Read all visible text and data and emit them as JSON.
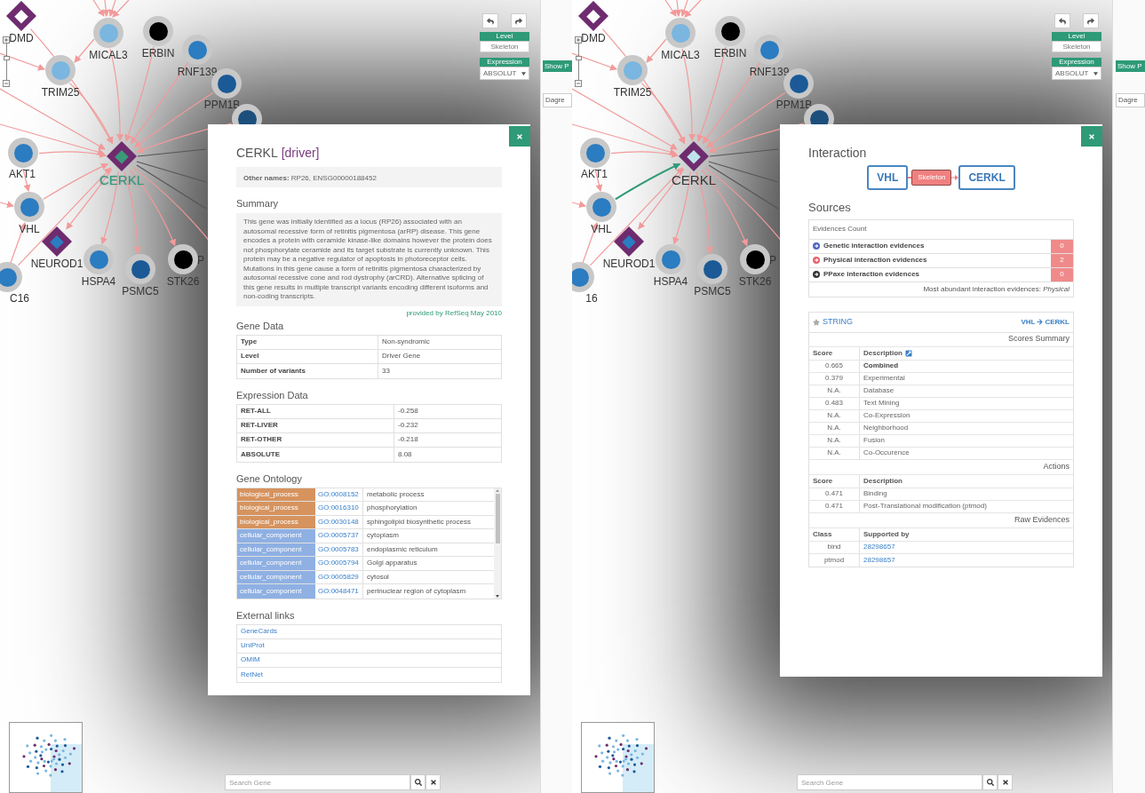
{
  "panes": [
    {
      "graph": {
        "nodes": [
          {
            "label": "DMD",
            "kind": "diamond",
            "color": "#ffffff",
            "selected": false,
            "edge_selected": false
          },
          {
            "label": "MICAL3",
            "kind": "circle",
            "color": "#7ab6df",
            "selected": false,
            "edge_selected": false
          },
          {
            "label": "ERBIN",
            "kind": "circle",
            "color": "#000000",
            "selected": false,
            "edge_selected": false
          },
          {
            "label": "RNF139",
            "kind": "circle",
            "color": "#2b7cc1",
            "selected": false,
            "edge_selected": false
          },
          {
            "label": "TRIM25",
            "kind": "circle",
            "color": "#7ab6df",
            "selected": false,
            "edge_selected": false
          },
          {
            "label": "PPM1B",
            "kind": "circle",
            "color": "#1b5a96",
            "selected": false,
            "edge_selected": false
          },
          {
            "kind": "circle",
            "color": "#1d4f7c",
            "selected": false,
            "edge_selected": false
          },
          {
            "label": "AKT1",
            "kind": "circle",
            "color": "#2b7cc1",
            "selected": false,
            "edge_selected": false
          },
          {
            "label": "CERKL",
            "kind": "diamond",
            "color": "#3a9a7a",
            "selected": true
          },
          {
            "label": "VHL",
            "kind": "circle",
            "color": "#2b7cc1",
            "selected": false,
            "edge_selected": false
          },
          {
            "label": "NEUROD1",
            "kind": "diamond",
            "color": "#2b7cc1",
            "selected": false,
            "edge_selected": false
          },
          {
            "label": "HSPA4",
            "kind": "circle",
            "color": "#2b7cc1",
            "selected": false,
            "edge_selected": false
          },
          {
            "label": "PSMC5",
            "kind": "circle",
            "color": "#1b5a96",
            "selected": false,
            "edge_selected": false
          },
          {
            "label": "STK26",
            "kind": "circle",
            "color": "#000000",
            "selected": false,
            "edge_selected": false
          },
          {
            "label": "P",
            "kind": "covered",
            "selected": false,
            "edge_selected": false
          },
          {
            "label": "C16",
            "kind": "circle",
            "color": "#2b7cc1",
            "selected": false,
            "edge_selected": false
          }
        ]
      },
      "zoom": {
        "level": 0.65
      },
      "toolbar": {
        "level_label": "Level",
        "level_value": "Skeleton",
        "expression_label": "Expression",
        "expression_value": "ABSOLUT"
      },
      "side_buttons": [
        {
          "label": "Show P",
          "kind": "primary"
        },
        {
          "label": "Dagre",
          "kind": "plain"
        }
      ],
      "search": {
        "placeholder": "Search Gene"
      },
      "modal": {
        "kind": "gene",
        "title": "CERKL",
        "tag": "[driver]",
        "other_names": "**Other names:** RP26, ENSG00000188452",
        "summary_heading": "Summary",
        "summary": "This gene was initially identified as a locus (RP26) associated with an autosomal recessive form of retinitis pigmentosa (arRP) disease. This gene encodes a protein with ceramide kinase-like domains however the protein does not phosphorylate ceramide and its target substrate is currently unknown. This protein may be a negative regulator of apoptosis in photoreceptor cells. Mutations in this gene cause a form of retinitis pigmentosa characterized by autosomal recessive cone and rod dystrophy (arCRD). Alternative splicing of this gene results in multiple transcript variants encoding different isoforms and non-coding transcripts.",
        "source_note": "provided by RefSeq May 2010",
        "gene_data": {
          "heading": "Gene Data",
          "rows": [
            {
              "label": "Type",
              "value": "Non-syndromic"
            },
            {
              "label": "Level",
              "value": "Driver Gene"
            },
            {
              "label": "Number of variants",
              "value": "33"
            }
          ]
        },
        "expression": {
          "heading": "Expression Data",
          "rows": [
            {
              "label": "RET-ALL",
              "value": "-0.258"
            },
            {
              "label": "RET-LIVER",
              "value": "-0.232"
            },
            {
              "label": "RET-OTHER",
              "value": "-0.218"
            },
            {
              "label": "ABSOLUTE",
              "value": "8.08"
            }
          ]
        },
        "ontology": {
          "heading": "Gene Ontology",
          "rows": [
            {
              "category": "biological_process",
              "color": "#d6935e",
              "id": "GO:0008152",
              "term": "metabolic process"
            },
            {
              "category": "biological_process",
              "color": "#d6935e",
              "id": "GO:0016310",
              "term": "phosphorylation"
            },
            {
              "category": "biological_process",
              "color": "#d6935e",
              "id": "GO:0030148",
              "term": "sphingolipid biosynthetic process"
            },
            {
              "category": "cellular_component",
              "color": "#8fb0e3",
              "id": "GO:0005737",
              "term": "cytoplasm"
            },
            {
              "category": "cellular_component",
              "color": "#8fb0e3",
              "id": "GO:0005783",
              "term": "endoplasmic reticulum"
            },
            {
              "category": "cellular_component",
              "color": "#8fb0e3",
              "id": "GO:0005794",
              "term": "Golgi apparatus"
            },
            {
              "category": "cellular_component",
              "color": "#8fb0e3",
              "id": "GO:0005829",
              "term": "cytosol"
            },
            {
              "category": "cellular_component",
              "color": "#8fb0e3",
              "id": "GO:0048471",
              "term": "perinuclear region of cytoplasm"
            }
          ]
        },
        "links": {
          "heading": "External links",
          "items": [
            "GeneCards",
            "UniProt",
            "OMIM",
            "RetNet"
          ]
        }
      }
    },
    {
      "graph": {
        "nodes": [
          {
            "label": "DMD",
            "kind": "diamond",
            "color": "#ffffff",
            "selected": false,
            "edge_selected": false
          },
          {
            "label": "MICAL3",
            "kind": "circle",
            "color": "#7ab6df",
            "selected": false,
            "edge_selected": false
          },
          {
            "label": "ERBIN",
            "kind": "circle",
            "color": "#000000",
            "selected": false,
            "edge_selected": false
          },
          {
            "label": "RNF139",
            "kind": "circle",
            "color": "#2b7cc1",
            "selected": false,
            "edge_selected": false
          },
          {
            "label": "TRIM25",
            "kind": "circle",
            "color": "#7ab6df",
            "selected": false,
            "edge_selected": false
          },
          {
            "label": "PPM1B",
            "kind": "circle",
            "color": "#1b5a96",
            "selected": false,
            "edge_selected": false
          },
          {
            "kind": "circle",
            "color": "#1d4f7c",
            "selected": false,
            "edge_selected": false
          },
          {
            "label": "AKT1",
            "kind": "circle",
            "color": "#2b7cc1",
            "selected": false,
            "edge_selected": false
          },
          {
            "label": "CERKL",
            "kind": "diamond",
            "color": "#bfe3ea",
            "selected": false
          },
          {
            "label": "VHL",
            "kind": "circle",
            "color": "#2b7cc1",
            "selected": false,
            "edge_selected": true
          },
          {
            "label": "NEUROD1",
            "kind": "diamond",
            "color": "#2b7cc1",
            "selected": false,
            "edge_selected": false
          },
          {
            "label": "HSPA4",
            "kind": "circle",
            "color": "#2b7cc1",
            "selected": false,
            "edge_selected": false
          },
          {
            "label": "PSMC5",
            "kind": "circle",
            "color": "#1b5a96",
            "selected": false,
            "edge_selected": false
          },
          {
            "label": "STK26",
            "kind": "circle",
            "color": "#000000",
            "selected": false,
            "edge_selected": false
          },
          {
            "label": "P",
            "kind": "covered",
            "selected": false,
            "edge_selected": false
          },
          {
            "label": "16",
            "kind": "circle",
            "color": "#2b7cc1",
            "selected": false,
            "edge_selected": false
          }
        ]
      },
      "zoom": {
        "level": 0.65
      },
      "toolbar": {
        "level_label": "Level",
        "level_value": "Skeleton",
        "expression_label": "Expression",
        "expression_value": "ABSOLUT"
      },
      "side_buttons": [
        {
          "label": "Show P",
          "kind": "primary"
        },
        {
          "label": "Dagre",
          "kind": "plain"
        }
      ],
      "search": {
        "placeholder": "Search Gene"
      },
      "modal": {
        "kind": "interaction",
        "title": "Interaction",
        "source": "VHL",
        "relation": "Skeleton",
        "target": "CERKL",
        "sources_heading": "Sources",
        "evidence": {
          "heading": "Evidences Count",
          "rows": [
            {
              "label": "Genetic interaction evidences",
              "color": "#4f63c4",
              "count": "0"
            },
            {
              "label": "Physical interaction evidences",
              "color": "#e5646e",
              "count": "2"
            },
            {
              "label": "PPaxe interaction evidences",
              "color": "#333333",
              "count": "0"
            }
          ],
          "note": "Most abundant interaction evidences: *Physical*"
        },
        "string": {
          "name": "STRING",
          "pair_source": "VHL",
          "pair_target": "CERKL",
          "scores_heading": "Scores Summary",
          "scores_columns": [
            "Score",
            "Description"
          ],
          "scores": [
            {
              "score": "0.665",
              "description": "Combined",
              "bold": true
            },
            {
              "score": "0.379",
              "description": "Experimental",
              "bold": false
            },
            {
              "score": "N.A.",
              "description": "Database",
              "bold": false
            },
            {
              "score": "0.483",
              "description": "Text Mining",
              "bold": false
            },
            {
              "score": "N.A.",
              "description": "Co-Expression",
              "bold": false
            },
            {
              "score": "N.A.",
              "description": "Neighborhood",
              "bold": false
            },
            {
              "score": "N.A.",
              "description": "Fusion",
              "bold": false
            },
            {
              "score": "N.A.",
              "description": "Co-Occurence",
              "bold": false
            }
          ],
          "actions_heading": "Actions",
          "actions_columns": [
            "Score",
            "Description"
          ],
          "actions": [
            {
              "score": "0.471",
              "description": "Binding"
            },
            {
              "score": "0.471",
              "description": "Post-Translational modification (ptmod)"
            }
          ],
          "raw_heading": "Raw Evidences",
          "raw_columns": [
            "Class",
            "Supported by"
          ],
          "raw": [
            {
              "class": "bind",
              "reference": "28298657"
            },
            {
              "class": "ptmod",
              "reference": "28298657"
            }
          ]
        }
      }
    }
  ]
}
